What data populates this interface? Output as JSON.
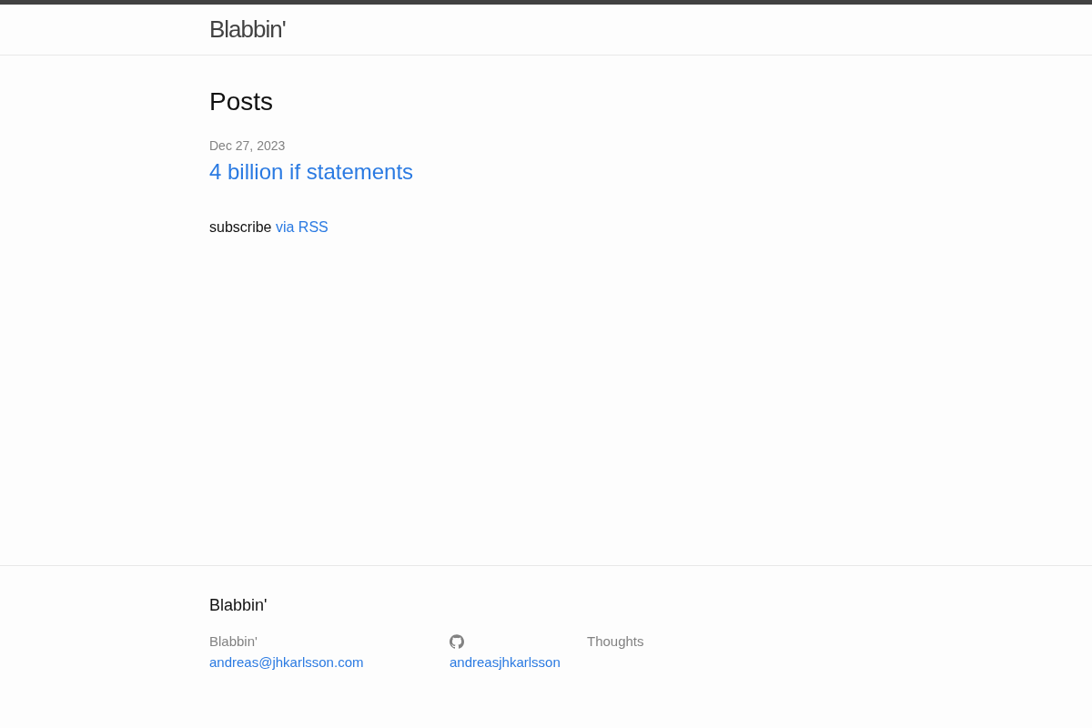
{
  "header": {
    "site_title": "Blabbin'"
  },
  "page": {
    "heading": "Posts",
    "posts": [
      {
        "date": "Dec 27, 2023",
        "title": "4 billion if statements"
      }
    ],
    "subscribe": {
      "text": "subscribe",
      "link": "via RSS"
    }
  },
  "footer": {
    "heading": "Blabbin'",
    "contact": {
      "name": "Blabbin'",
      "email": "andreas@jhkarlsson.com"
    },
    "social": {
      "github_username": "andreasjhkarlsson"
    },
    "description": "Thoughts"
  }
}
